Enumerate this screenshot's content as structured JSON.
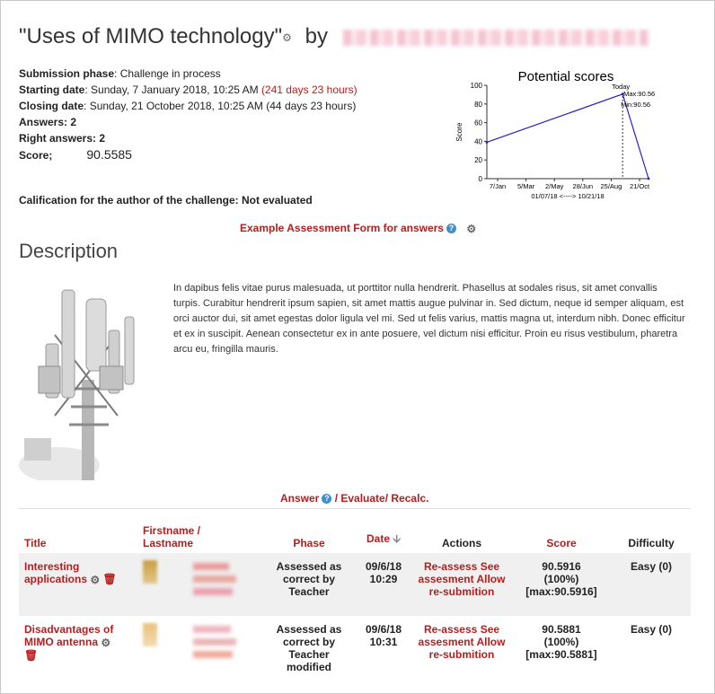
{
  "header": {
    "title": "\"Uses of MIMO technology\"",
    "by": "by"
  },
  "info": {
    "phase_label": "Submission phase",
    "phase_value": "Challenge in process",
    "start_label": "Starting date",
    "start_value": "Sunday, 7 January 2018, 10:25 AM",
    "start_extra": "(241 days 23 hours)",
    "close_label": "Closing date",
    "close_value": "Sunday, 21 October 2018, 10:25 AM (44 days 23 hours)",
    "answers_label": "Answers:",
    "answers_value": "2",
    "right_label": "Right answers:",
    "right_value": "2",
    "score_label": "Score;",
    "score_value": "90.5585"
  },
  "calification": "Calification for the author of the challenge: Not evaluated",
  "assessment_link": "Example Assessment Form for answers",
  "description": {
    "heading": "Description",
    "text": "In dapibus felis vitae purus malesuada, ut porttitor nulla hendrerit. Phasellus at sodales risus, sit amet convallis turpis. Curabitur hendrerit ipsum sapien, sit amet mattis augue pulvinar in. Sed dictum, neque id semper aliquam, est orci auctor dui, sit amet egestas dolor ligula vel mi. Sed ut felis varius, mattis magna ut, interdum nibh. Donec efficitur et ex in suscipit. Aenean consectetur ex in ante posuere, vel dictum nisi efficitur. Proin eu risus vestibulum, pharetra arcu eu, fringilla mauris."
  },
  "action_links": {
    "answer": "Answer",
    "evaluate": "/ Evaluate/",
    "recalc": "Recalc."
  },
  "table": {
    "headers": {
      "title": "Title",
      "firstname": "Firstname /",
      "lastname": "Lastname",
      "phase": "Phase",
      "date": "Date",
      "actions": "Actions",
      "score": "Score",
      "difficulty": "Difficulty"
    },
    "rows": [
      {
        "title": "Interesting applications",
        "phase": "Assessed as correct by Teacher",
        "date": "09/6/18",
        "time": "10:29",
        "action_reassess": "Re-assess",
        "action_see": "See assesment",
        "action_allow": "Allow re-submition",
        "score": "90.5916",
        "score_pct": "(100%)",
        "score_max": "[max:90.5916]",
        "difficulty": "Easy (0)"
      },
      {
        "title": "Disadvantages of MIMO antenna",
        "phase": "Assessed as correct by Teacher modified",
        "date": "09/6/18",
        "time": "10:31",
        "action_reassess": "Re-assess",
        "action_see": "See assesment",
        "action_allow": "Allow re-submition",
        "score": "90.5881",
        "score_pct": "(100%)",
        "score_max": "[max:90.5881]",
        "difficulty": "Easy (0)"
      }
    ]
  },
  "colors": {
    "link_red": "#b41e1e",
    "chart_line": "#2222cc"
  },
  "chart_data": {
    "type": "line",
    "title": "Potential scores",
    "xlabel": "01/07/18  <---->  10/21/18",
    "ylabel": "Score",
    "x_tick_labels": [
      "7/Jan",
      "5/Mar",
      "2/May",
      "28/Jun",
      "25/Aug",
      "21/Oct"
    ],
    "y_tick_labels": [
      "0",
      "20",
      "40",
      "60",
      "80",
      "100"
    ],
    "ylim": [
      0,
      100
    ],
    "xlim": [
      "2018-01-07",
      "2018-10-21"
    ],
    "grid": false,
    "series": [
      {
        "x": [
          "2018-01-07",
          "2018-09-05",
          "2018-10-21"
        ],
        "values": [
          39,
          90.56,
          0
        ]
      }
    ],
    "annotations": {
      "today_label": "Today",
      "today_x": "2018-09-05",
      "max_label": "Max:90.56",
      "min_label": "Min:90.56"
    }
  }
}
